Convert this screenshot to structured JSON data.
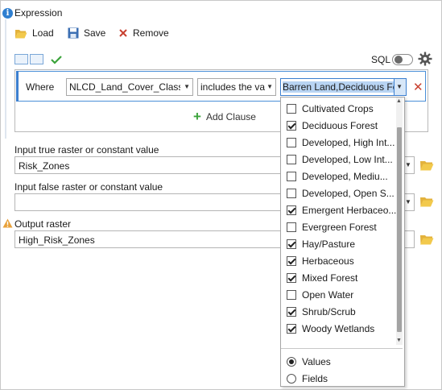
{
  "section_title": "Expression",
  "toolbar": {
    "load_label": "Load",
    "save_label": "Save",
    "remove_label": "Remove"
  },
  "sql_label": "SQL",
  "clause": {
    "where_label": "Where",
    "field_value": "NLCD_Land_Cover_Class",
    "operator_value": "includes the va",
    "value_text": "Barren Land,Deciduous Fo"
  },
  "add_clause_label": "Add Clause",
  "true_raster": {
    "label": "Input true raster or constant value",
    "value": "Risk_Zones"
  },
  "false_raster": {
    "label": "Input false raster or constant value",
    "value": ""
  },
  "output_raster": {
    "label": "Output raster",
    "value": "High_Risk_Zones"
  },
  "dropdown": {
    "items": [
      {
        "label": "Cultivated Crops",
        "checked": false
      },
      {
        "label": "Deciduous Forest",
        "checked": true
      },
      {
        "label": "Developed, High Int...",
        "checked": false
      },
      {
        "label": "Developed, Low Int...",
        "checked": false
      },
      {
        "label": "Developed, Mediu...",
        "checked": false
      },
      {
        "label": "Developed, Open S...",
        "checked": false
      },
      {
        "label": "Emergent Herbaceo...",
        "checked": true
      },
      {
        "label": "Evergreen Forest",
        "checked": false
      },
      {
        "label": "Hay/Pasture",
        "checked": true
      },
      {
        "label": "Herbaceous",
        "checked": true
      },
      {
        "label": "Mixed Forest",
        "checked": true
      },
      {
        "label": "Open Water",
        "checked": false
      },
      {
        "label": "Shrub/Scrub",
        "checked": true
      },
      {
        "label": "Woody Wetlands",
        "checked": true
      }
    ],
    "mode_options": [
      {
        "label": "Values",
        "selected": true
      },
      {
        "label": "Fields",
        "selected": false
      }
    ]
  },
  "colors": {
    "accent": "#3c7fcf",
    "selection": "#b8d4f3",
    "remove": "#c8402f",
    "add": "#3ba33b",
    "warning": "#e8a13a"
  }
}
